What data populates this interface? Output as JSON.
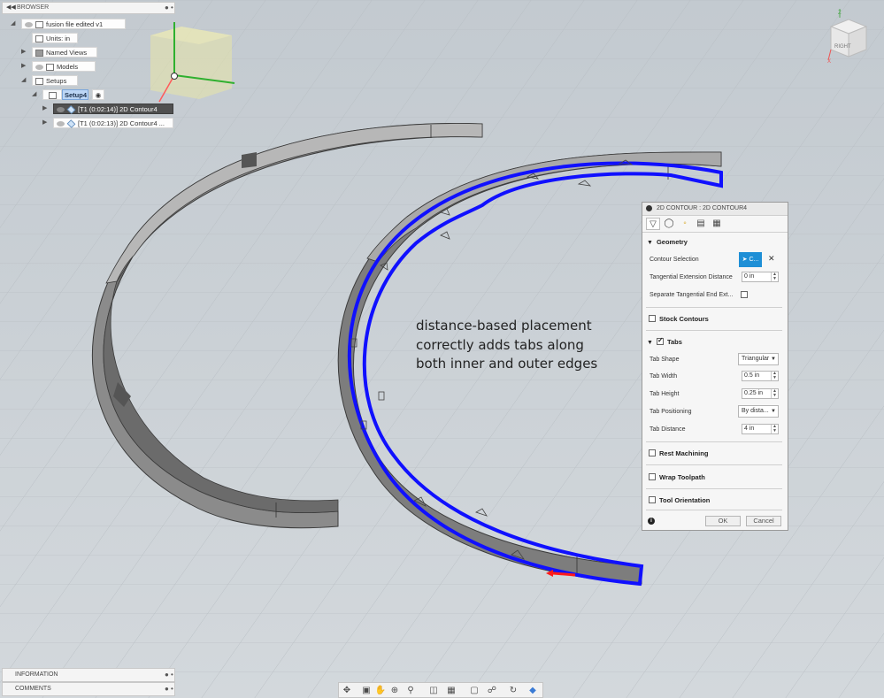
{
  "browser": {
    "header_title": "BROWSER",
    "document_name": "fusion file edited v1",
    "units": "Units: in",
    "named_views": "Named Views",
    "models": "Models",
    "setups": "Setups",
    "setup_name": "Setup4",
    "operations": [
      "[T1 (0:02:14)] 2D Contour4",
      "[T1 (0:02:13)] 2D Contour4 ..."
    ]
  },
  "annotation": {
    "lines": [
      "distance-based placement",
      "correctly adds tabs along",
      "both inner and outer edges"
    ]
  },
  "dialog": {
    "title": "2D CONTOUR : 2D CONTOUR4",
    "geometry": {
      "header": "Geometry",
      "contour_selection_label": "Contour Selection",
      "contour_selection_button": "C...",
      "tangential_extension_label": "Tangential Extension Distance",
      "tangential_extension_value": "0 in",
      "separate_tangential_label": "Separate Tangential End Ext..."
    },
    "stock_contours": "Stock Contours",
    "tabs": {
      "header": "Tabs",
      "enabled": true,
      "tab_shape_label": "Tab Shape",
      "tab_shape_value": "Triangular",
      "tab_width_label": "Tab Width",
      "tab_width_value": "0.5 in",
      "tab_height_label": "Tab Height",
      "tab_height_value": "0.25 in",
      "tab_positioning_label": "Tab Positioning",
      "tab_positioning_value": "By dista...",
      "tab_distance_label": "Tab Distance",
      "tab_distance_value": "4 in"
    },
    "rest_machining": "Rest Machining",
    "wrap_toolpath": "Wrap Toolpath",
    "tool_orientation": "Tool Orientation",
    "ok_label": "OK",
    "cancel_label": "Cancel"
  },
  "bottom": {
    "information": "INFORMATION",
    "comments": "COMMENTS"
  },
  "viewcube": {
    "face_label": "RIGHT",
    "axis_z": "Z",
    "axis_x": "X"
  },
  "colors": {
    "toolpath_blue": "#1010ff",
    "selection_blue": "#1e8fd6",
    "part_gray": "#6e6e6e"
  }
}
